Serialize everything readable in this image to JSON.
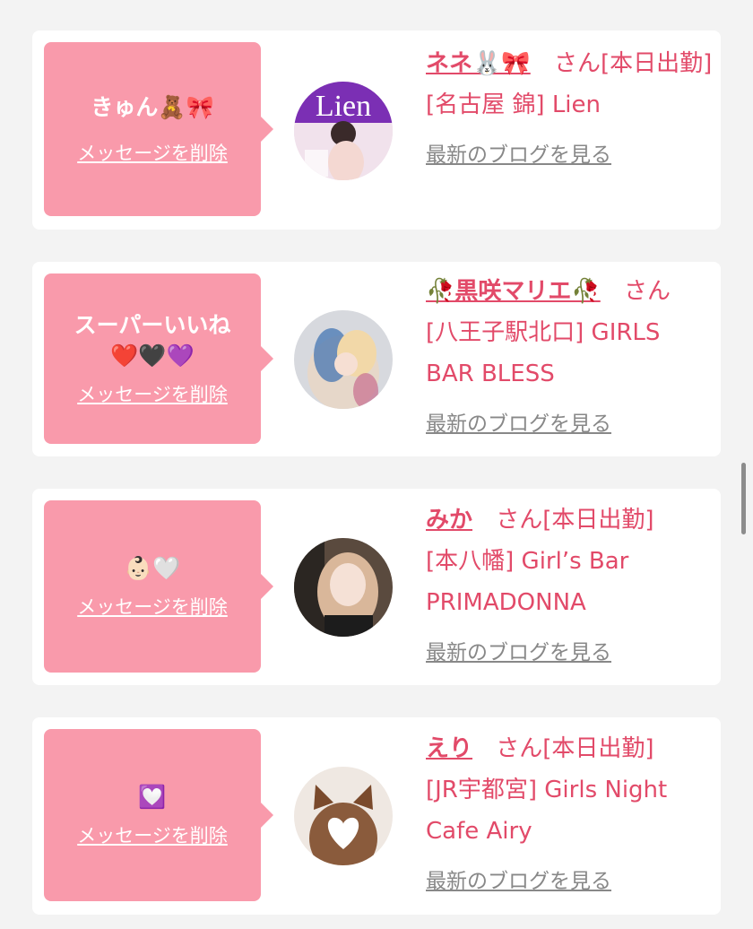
{
  "cards": [
    {
      "reaction": "きゅん🧸🎀",
      "delete_label": "メッセージを削除",
      "name": "ネネ🐰🎀",
      "suffix": "さん[本日出勤]",
      "shop": "[名古屋 錦] Lien",
      "blog_label": "最新のブログを見る",
      "avatar_text": "Lien"
    },
    {
      "reaction": "スーパーいいね\n❤️🖤💜",
      "delete_label": "メッセージを削除",
      "name": "🥀黒咲マリエ🥀",
      "suffix": "さん",
      "shop": "[八王子駅北口] GIRLS BAR BLESS",
      "blog_label": "最新のブログを見る"
    },
    {
      "reaction": "👶🏻🤍",
      "delete_label": "メッセージを削除",
      "name": "みか",
      "suffix": "さん[本日出勤]",
      "shop": "[本八幡] Girl’s Bar PRIMADONNA",
      "blog_label": "最新のブログを見る"
    },
    {
      "reaction": "💟",
      "delete_label": "メッセージを削除",
      "name": "えり",
      "suffix": "さん[本日出勤]",
      "shop": "[JR宇都宮] Girls Night Cafe Airy",
      "blog_label": "最新のブログを見る"
    }
  ]
}
